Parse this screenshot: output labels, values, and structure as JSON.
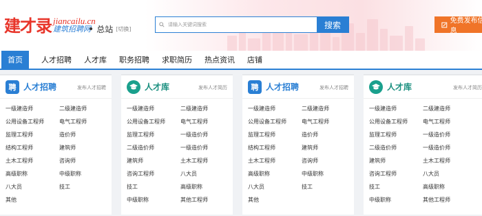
{
  "brand": {
    "logo_main": "建才录",
    "domain": "jiancailu.cn",
    "tagline": "建筑招聘网"
  },
  "site": {
    "dot": "•",
    "name": "总站",
    "switch": "[切换]"
  },
  "search": {
    "placeholder": "请输入关键词搜索",
    "button": "搜索"
  },
  "post_button": {
    "label": "免费发布信息"
  },
  "nav": [
    "首页",
    "人才招聘",
    "人才库",
    "职务招聘",
    "求职简历",
    "热点资讯",
    "店铺"
  ],
  "colors": {
    "accent": "#2a7fd4",
    "brand_red": "#e8352a",
    "orange": "#f07428",
    "teal": "#1aa08d"
  },
  "cards": [
    {
      "icon": "聘",
      "title": "人才招聘",
      "more": "发布人才招聘",
      "items": [
        "一级建造师",
        "二级建造师",
        "公用设备工程师",
        "电气工程师",
        "监理工程师",
        "造价师",
        "结构工程师",
        "建筑师",
        "土木工程师",
        "咨询师",
        "高级职称",
        "中级职称",
        "八大员",
        "技工",
        "其他"
      ]
    },
    {
      "icon": "mortarboard-icon",
      "title": "人才库",
      "more": "发布人才简历",
      "items": [
        "一级建造师",
        "二级建造师",
        "公用设备工程师",
        "电气工程师",
        "监理工程师",
        "一级造价师",
        "二级造价师",
        "一级造价师",
        "建筑师",
        "土木工程师",
        "咨询工程师",
        "八大员",
        "技工",
        "高级职称",
        "中级职称",
        "其他工程师"
      ]
    },
    {
      "icon": "聘",
      "title": "人才招聘",
      "more": "发布人才招聘",
      "items": [
        "一级建造师",
        "二级建造师",
        "公用设备工程师",
        "电气工程师",
        "监理工程师",
        "造价师",
        "结构工程师",
        "建筑师",
        "土木工程师",
        "咨询师",
        "高级职称",
        "中级职称",
        "八大员",
        "技工",
        "其他"
      ]
    },
    {
      "icon": "mortarboard-icon",
      "title": "人才库",
      "more": "发布人才简历",
      "items": [
        "一级建造师",
        "二级建造师",
        "公用设备工程师",
        "电气工程师",
        "监理工程师",
        "一级造价师",
        "二级造价师",
        "一级造价师",
        "建筑师",
        "土木工程师",
        "咨询工程师",
        "八大员",
        "技工",
        "高级职称",
        "中级职称",
        "其他工程师"
      ]
    }
  ]
}
